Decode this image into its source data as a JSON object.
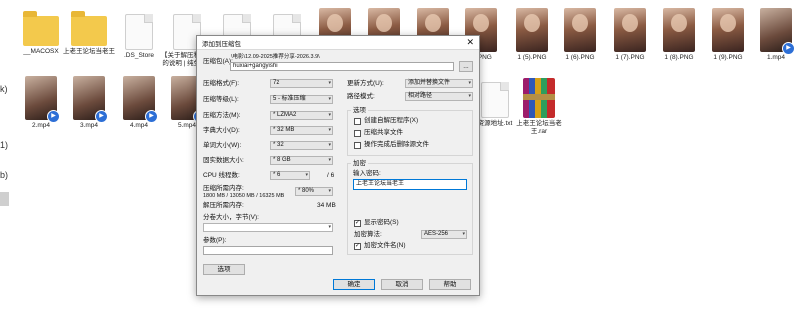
{
  "sidebar": {
    "marks": [
      "k)",
      "1)",
      "b)"
    ]
  },
  "files": [
    {
      "name": "__MACOSX",
      "type": "folder"
    },
    {
      "name": "上老王论坛当老王",
      "type": "folder"
    },
    {
      "name": ".DS_Store",
      "type": "doc"
    },
    {
      "name": "【关于解压和观看的说明 | 纯免费】]",
      "type": "doc"
    },
    {
      "name": "",
      "type": "doc"
    },
    {
      "name": "",
      "type": "doc"
    },
    {
      "name": "",
      "type": "photo"
    },
    {
      "name": "",
      "type": "photo"
    },
    {
      "name": "",
      "type": "photo"
    },
    {
      "name": "4).PNG",
      "type": "photo"
    },
    {
      "name": "1 (5).PNG",
      "type": "photo"
    },
    {
      "name": "1 (6).PNG",
      "type": "photo"
    },
    {
      "name": "1 (7).PNG",
      "type": "photo"
    },
    {
      "name": "1 (8).PNG",
      "type": "photo"
    },
    {
      "name": "1 (9).PNG",
      "type": "photo"
    },
    {
      "name": "1.mp4",
      "type": "video"
    },
    {
      "name": "2.mp4",
      "type": "video"
    },
    {
      "name": "3.mp4",
      "type": "video"
    },
    {
      "name": "4.mp4",
      "type": "video"
    },
    {
      "name": "5.mp4",
      "type": "video"
    },
    {
      "name": "资源地址.txt",
      "type": "doc"
    },
    {
      "name": "上老王论坛当老王.rar",
      "type": "rar"
    }
  ],
  "dialog": {
    "title": "添加到压缩包",
    "close": "✕",
    "archive_label": "压缩包(A):",
    "archive_path": "\\电影\\12.09-2025推荐分享-2026.3.9\\",
    "archive_name": "huxiai+gangyishi",
    "browse": "...",
    "format_label": "压缩格式(F):",
    "format_value": "7z",
    "level_label": "压缩等级(L):",
    "level_value": "5 - 标准压缩",
    "method_label": "压缩方法(M):",
    "method_value": "* LZMA2",
    "dict_label": "字典大小(D):",
    "dict_value": "* 32 MB",
    "word_label": "单词大小(W):",
    "word_value": "* 32",
    "solid_label": "固实数据大小:",
    "solid_value": "* 8 GB",
    "cpu_label": "CPU 线程数:",
    "cpu_value": "* 6",
    "cpu_total": "/ 6",
    "mem_label": "压缩所需内存:",
    "mem_detail": "1800 MB / 13050 MB / 16325 MB",
    "mem_percent": "* 80%",
    "decomp_label": "解压所需内存:",
    "decomp_value": "34 MB",
    "split_label": "分卷大小，字节(V):",
    "split_value": "",
    "params_label": "参数(P):",
    "params_value": "",
    "options_button": "选项",
    "update_label": "更新方式(U):",
    "update_value": "添加并替换文件",
    "path_label": "路径模式:",
    "path_value": "相对路径",
    "options_group": "选项",
    "opt_sfx": "创建自解压程序(X)",
    "opt_shared": "压缩共享文件",
    "opt_delete": "操作完成后删除源文件",
    "enc_group": "加密",
    "password_label": "输入密码:",
    "password_value": "上老王论坛当老王",
    "show_password": "显示密码(S)",
    "enc_method_label": "加密算法:",
    "enc_method_value": "AES-256",
    "encrypt_names": "加密文件名(N)",
    "ok": "确定",
    "cancel": "取消",
    "help": "帮助"
  }
}
